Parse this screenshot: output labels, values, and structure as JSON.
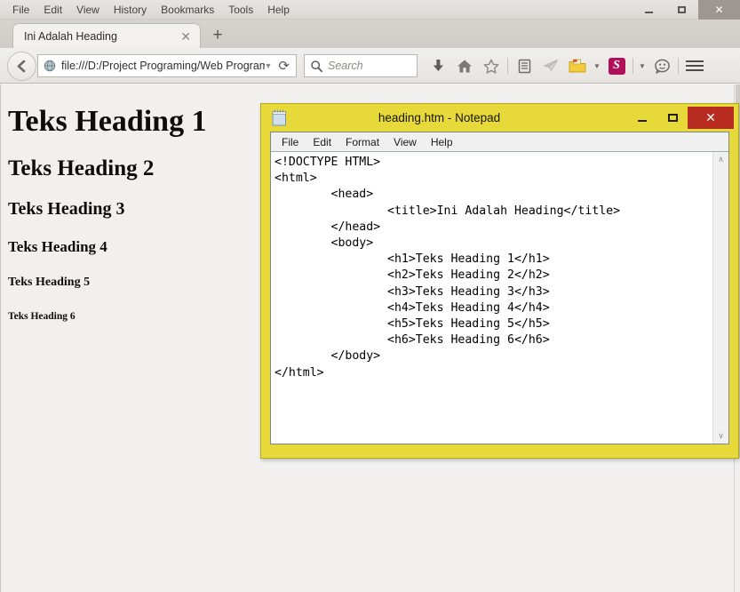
{
  "browser": {
    "menu": [
      "File",
      "Edit",
      "View",
      "History",
      "Bookmarks",
      "Tools",
      "Help"
    ],
    "window_controls": {
      "minimize": "minimize-icon",
      "maximize": "maximize-icon",
      "close": "✕"
    },
    "tab": {
      "title": "Ini Adalah Heading",
      "close_glyph": "✕",
      "new_tab_glyph": "+"
    },
    "nav": {
      "back_glyph": "←",
      "url": "file:///D:/Project Programing/Web Programi",
      "url_dropdown_glyph": "▼",
      "reload_glyph": "⟳",
      "search_placeholder": "Search"
    },
    "toolbar_icons": [
      {
        "name": "download-icon",
        "glyph": "⬇"
      },
      {
        "name": "home-icon",
        "glyph": "⌂"
      },
      {
        "name": "bookmark-star-icon",
        "glyph": "☆"
      },
      {
        "name": "reading-list-icon",
        "glyph": "὜b"
      },
      {
        "name": "send-tab-icon",
        "glyph": "➤"
      },
      {
        "name": "folder-icon",
        "glyph": "📁"
      },
      {
        "name": "skype-icon",
        "label": "S"
      }
    ]
  },
  "page": {
    "headings": [
      {
        "level": "h1",
        "text": "Teks Heading 1"
      },
      {
        "level": "h2",
        "text": "Teks Heading 2"
      },
      {
        "level": "h3",
        "text": "Teks Heading 3"
      },
      {
        "level": "h4",
        "text": "Teks Heading 4"
      },
      {
        "level": "h5",
        "text": "Teks Heading 5"
      },
      {
        "level": "h6",
        "text": "Teks Heading 6"
      }
    ]
  },
  "notepad": {
    "title": "heading.htm - Notepad",
    "menu": [
      "File",
      "Edit",
      "Format",
      "View",
      "Help"
    ],
    "window_controls": {
      "minimize": "minimize-icon",
      "maximize": "maximize-icon",
      "close": "✕"
    },
    "scrollbar": {
      "up_glyph": "∧",
      "down_glyph": "∨"
    },
    "content": "<!DOCTYPE HTML>\n<html>\n        <head>\n                <title>Ini Adalah Heading</title>\n        </head>\n        <body>\n                <h1>Teks Heading 1</h1>\n                <h2>Teks Heading 2</h2>\n                <h3>Teks Heading 3</h3>\n                <h4>Teks Heading 4</h4>\n                <h5>Teks Heading 5</h5>\n                <h6>Teks Heading 6</h6>\n        </body>\n</html>"
  },
  "colors": {
    "notepad_frame": "#e8d93a",
    "notepad_close": "#b72b20",
    "skype_badge": "#b0105a",
    "browser_chrome": "#e6e3e0"
  }
}
